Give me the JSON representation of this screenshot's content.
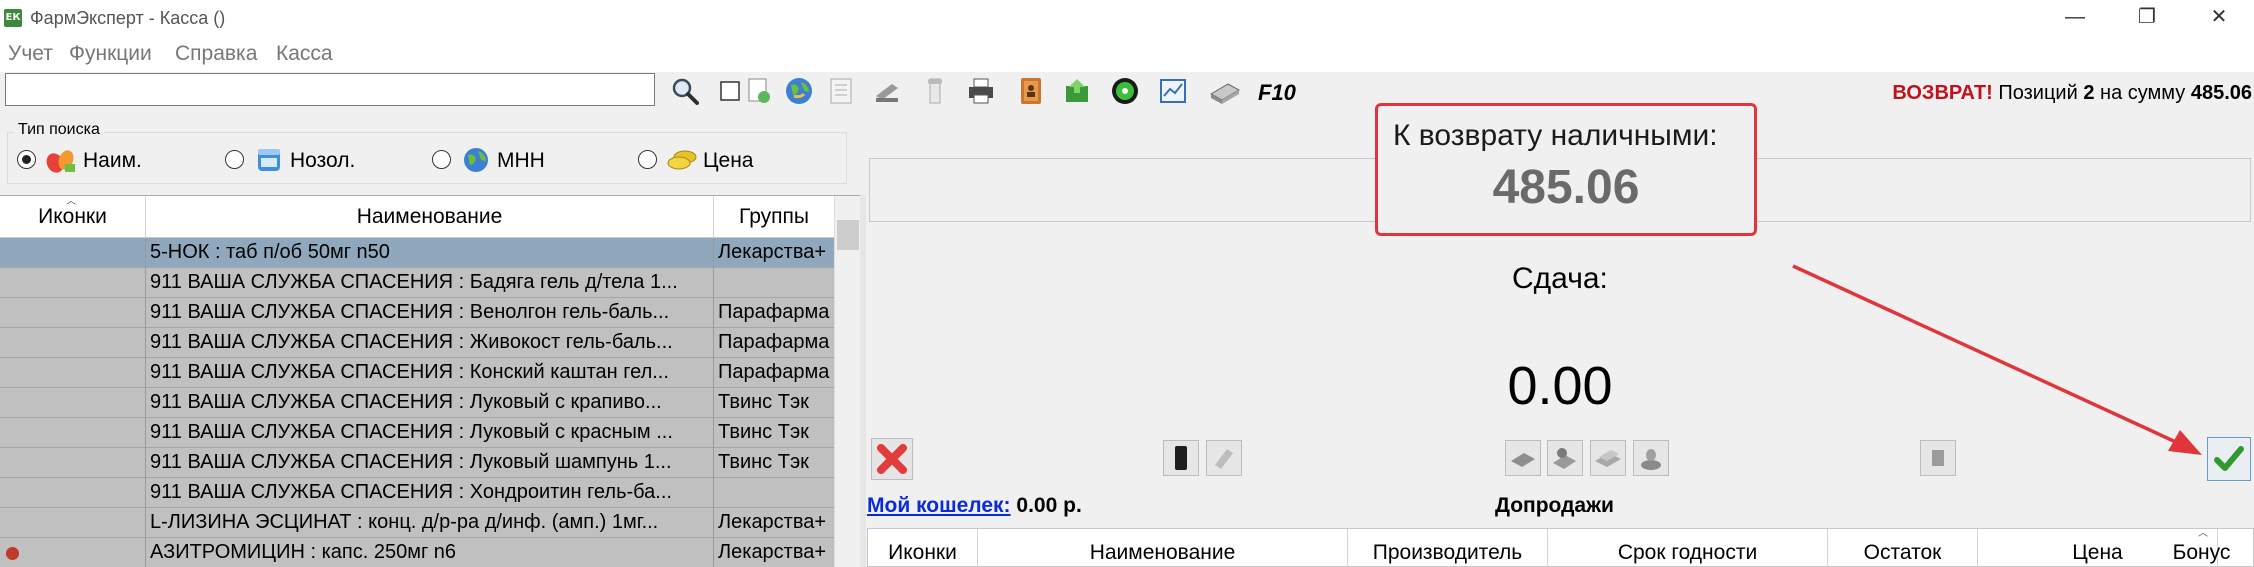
{
  "window": {
    "title": "ФармЭксперт - Касса ()",
    "app_icon_text": "ЕК",
    "buttons": {
      "minimize": "—",
      "restore": "❐",
      "close": "✕"
    }
  },
  "menu": [
    "Учет",
    "Функции",
    "Справка",
    "Касса"
  ],
  "search": {
    "value": "",
    "placeholder": ""
  },
  "toolbar": {
    "hotkey": "F10",
    "icons": [
      "search-icon",
      "checkbox-icon",
      "document-refresh-icon",
      "globe-icon",
      "notes-icon",
      "scanner-icon",
      "receipt-roll-icon",
      "printer-icon",
      "contact-book-icon",
      "green-refresh-icon",
      "cd-icon",
      "chart-window-icon",
      "cash-register-icon"
    ]
  },
  "search_type": {
    "legend": "Тип поиска",
    "options": [
      {
        "label": "Наим.",
        "icon": "pills-icon",
        "checked": true
      },
      {
        "label": "Нозол.",
        "icon": "medicine-jar-icon",
        "checked": false
      },
      {
        "label": "МНН",
        "icon": "globe-icon",
        "checked": false
      },
      {
        "label": "Цена",
        "icon": "coins-icon",
        "checked": false
      }
    ]
  },
  "products_grid": {
    "columns": [
      "Иконки",
      "Наименование",
      "Группы"
    ],
    "rows": [
      {
        "icons": "",
        "name": "5-НОК : таб п/об 50мг n50",
        "group": "Лекарства+",
        "selected": true,
        "badge": false
      },
      {
        "icons": "",
        "name": "911 ВАША СЛУЖБА СПАСЕНИЯ : Бадяга гель д/тела 1...",
        "group": "",
        "selected": false,
        "badge": false
      },
      {
        "icons": "",
        "name": "911 ВАША СЛУЖБА СПАСЕНИЯ : Венолгон гель-баль...",
        "group": "Парафарма",
        "selected": false,
        "badge": false
      },
      {
        "icons": "",
        "name": "911 ВАША СЛУЖБА СПАСЕНИЯ : Живокост гель-баль...",
        "group": "Парафарма",
        "selected": false,
        "badge": false
      },
      {
        "icons": "",
        "name": "911 ВАША СЛУЖБА СПАСЕНИЯ : Конский каштан гел...",
        "group": "Парафарма",
        "selected": false,
        "badge": false
      },
      {
        "icons": "",
        "name": "911 ВАША СЛУЖБА СПАСЕНИЯ : Луковый с крапиво...",
        "group": "Твинс Тэк",
        "selected": false,
        "badge": false
      },
      {
        "icons": "",
        "name": "911 ВАША СЛУЖБА СПАСЕНИЯ : Луковый с красным ...",
        "group": "Твинс Тэк",
        "selected": false,
        "badge": false
      },
      {
        "icons": "",
        "name": "911 ВАША СЛУЖБА СПАСЕНИЯ : Луковый шампунь 1...",
        "group": "Твинс Тэк",
        "selected": false,
        "badge": false
      },
      {
        "icons": "",
        "name": "911 ВАША СЛУЖБА СПАСЕНИЯ : Хондроитин гель-ба...",
        "group": "",
        "selected": false,
        "badge": false
      },
      {
        "icons": "",
        "name": "L-ЛИЗИНА ЭСЦИНАТ : конц. д/р-ра д/инф. (амп.) 1мг...",
        "group": "Лекарства+",
        "selected": false,
        "badge": false
      },
      {
        "icons": "",
        "name": "АЗИТРОМИЦИН : капс. 250мг n6",
        "group": "Лекарства+",
        "selected": false,
        "badge": true
      }
    ]
  },
  "status": {
    "mode": "ВОЗВРАТ!",
    "positions_label": "Позиций",
    "positions": "2",
    "sum_label": "на сумму",
    "sum": "485.06"
  },
  "refund": {
    "label": "К возврату наличными:",
    "amount": "485.06"
  },
  "change": {
    "label": "Сдача:",
    "amount": "0.00"
  },
  "action_buttons": [
    "cancel-x-icon",
    "phone-icon",
    "receipt-icon",
    "cash-card-icon",
    "cash-coins-icon",
    "banknotes-icon",
    "coin-stack-icon",
    "clipboard-icon",
    "checkmark-icon"
  ],
  "wallet": {
    "link": "Мой кошелек:",
    "balance": "0.00 р."
  },
  "upsell": {
    "title": "Допродажи",
    "columns": [
      "Иконки",
      "Наименование",
      "Производитель",
      "Срок годности",
      "Остаток",
      "Цена",
      "Бонус"
    ]
  },
  "colors": {
    "accent_red": "#e0363b",
    "return_red": "#c0121e",
    "link_blue": "#0a2bd6",
    "selected_row": "#8fa8bd",
    "row_gray": "#c0c0c0"
  }
}
